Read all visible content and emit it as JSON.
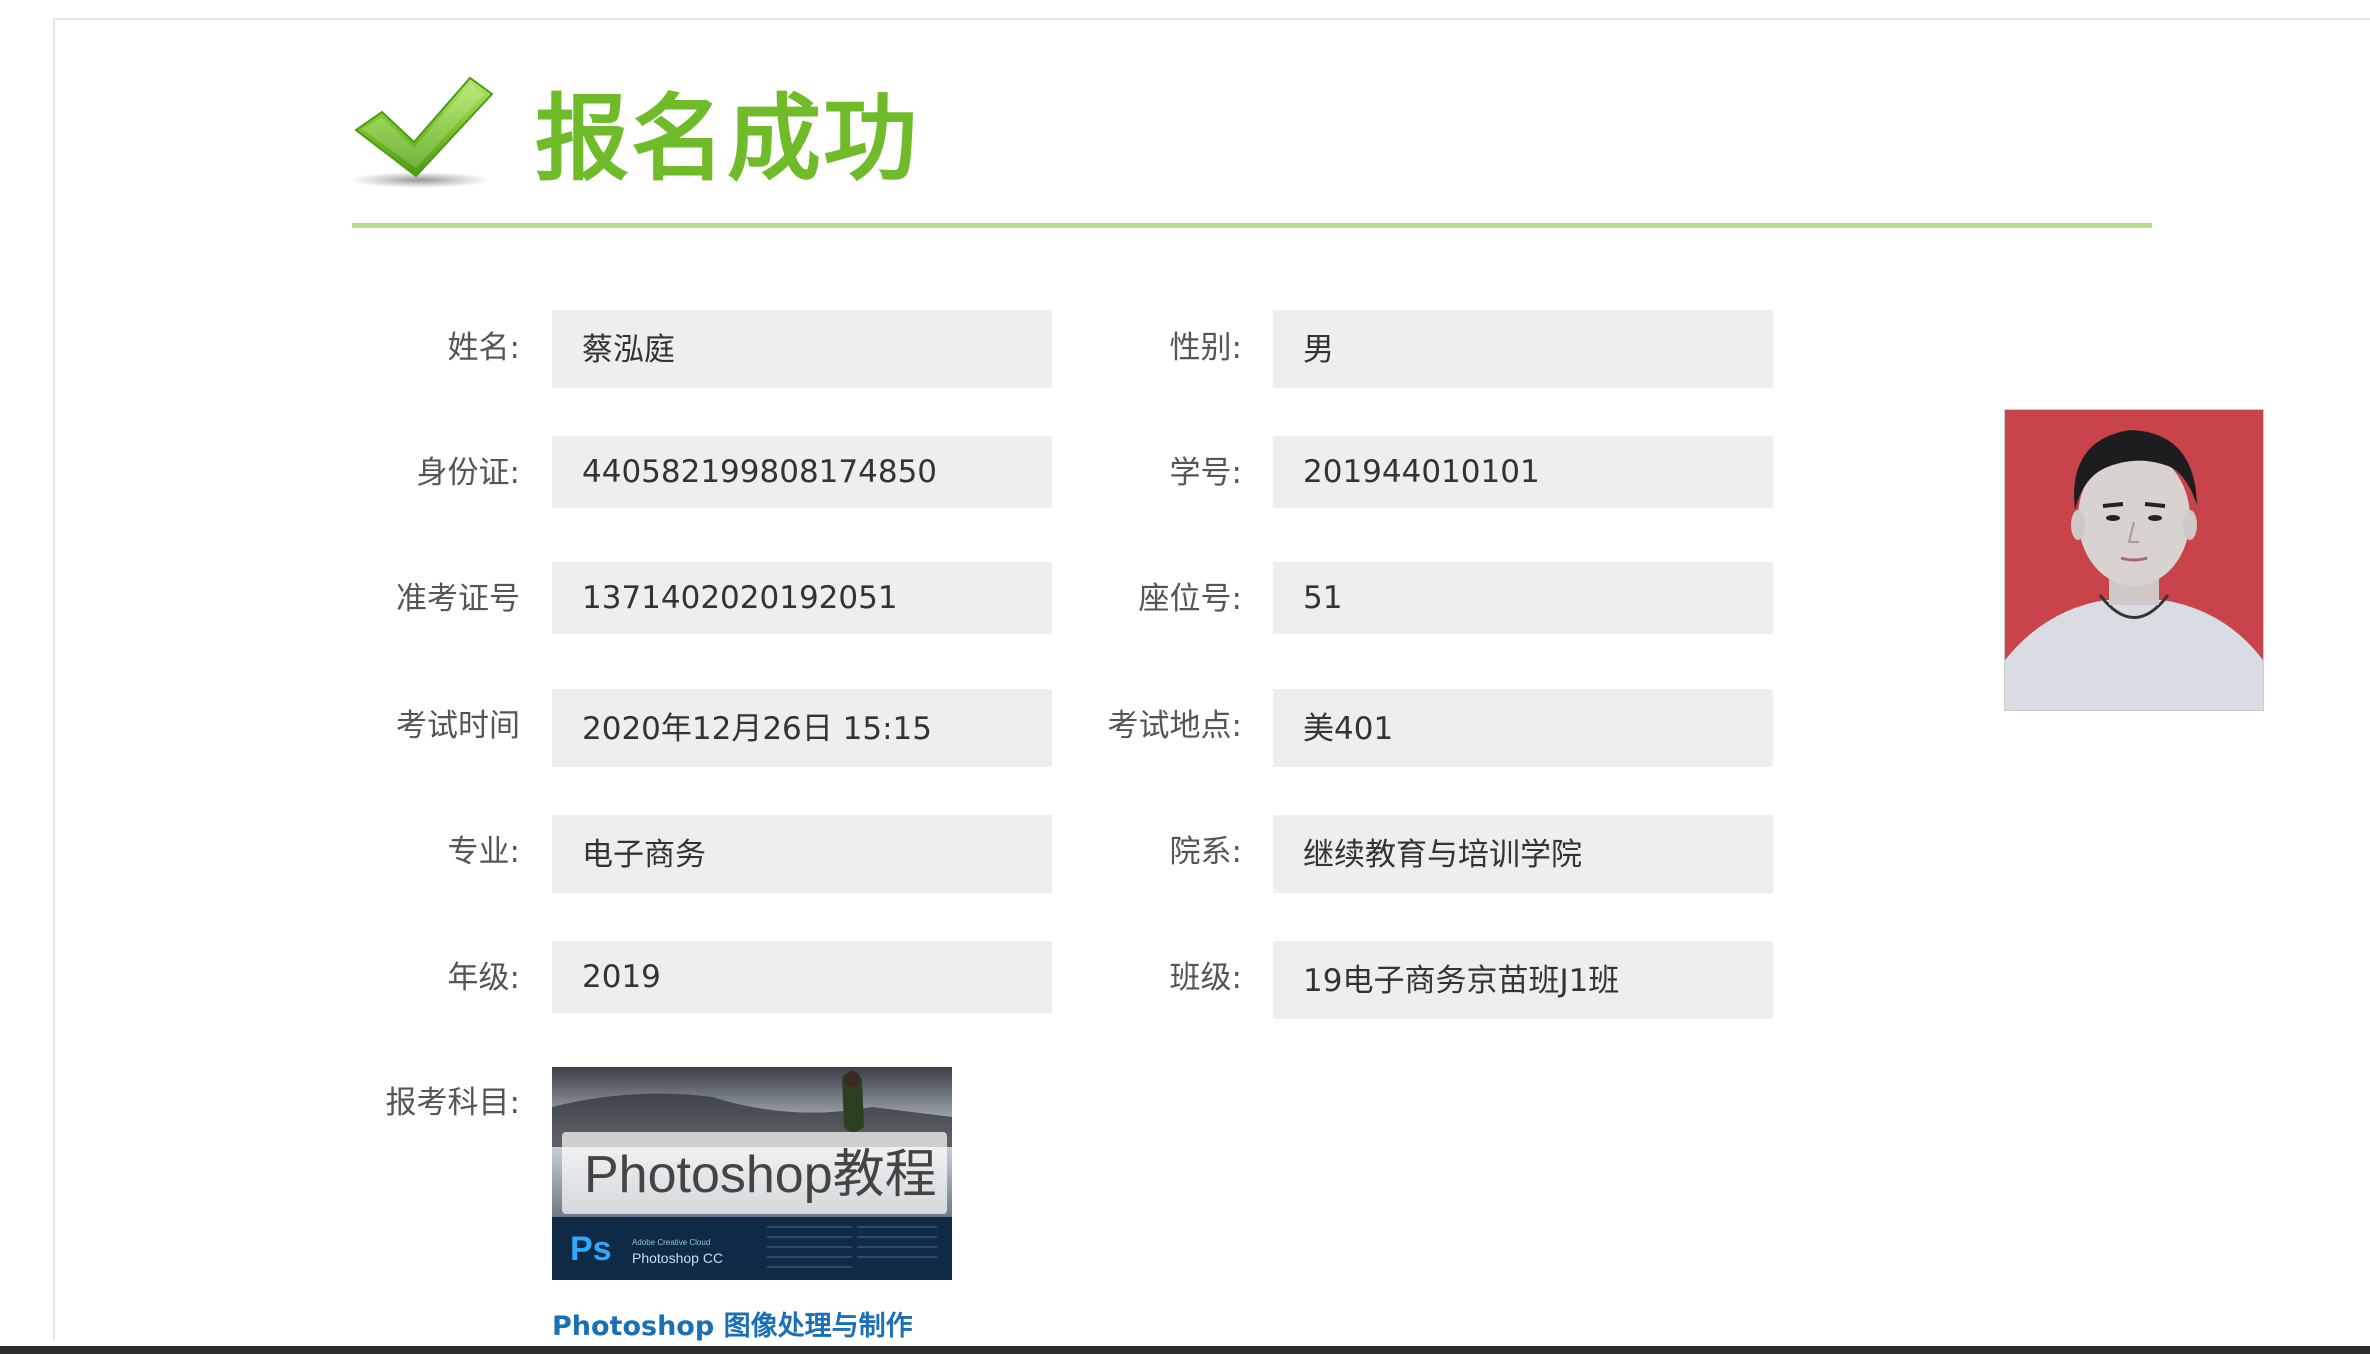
{
  "header": {
    "title": "报名成功",
    "check_icon": "checkmark-icon",
    "accent_color": "#6fbb2a"
  },
  "fields": {
    "name_label": "姓名:",
    "name_value": "蔡泓庭",
    "gender_label": "性别:",
    "gender_value": "男",
    "id_label": "身份证:",
    "id_value": "440582199808174850",
    "student_no_label": "学号:",
    "student_no_value": "201944010101",
    "ticket_label": "准考证号",
    "ticket_value": "1371402020192051",
    "seat_label": "座位号:",
    "seat_value": "51",
    "time_label": "考试时间",
    "time_value": "2020年12月26日 15:15",
    "place_label": "考试地点:",
    "place_value": "美401",
    "major_label": "专业:",
    "major_value": "电子商务",
    "dept_label": "院系:",
    "dept_value": "继续教育与培训学院",
    "grade_label": "年级:",
    "grade_value": "2019",
    "class_label": "班级:",
    "class_value": "19电子商务京苗班J1班",
    "subject_label": "报考科目:"
  },
  "course": {
    "image_text": "Photoshop教程",
    "image_sub": "Photoshop CC",
    "image_badge": "Ps",
    "image_brand": "Adobe Creative Cloud",
    "link_text": "Photoshop 图像处理与制作"
  }
}
